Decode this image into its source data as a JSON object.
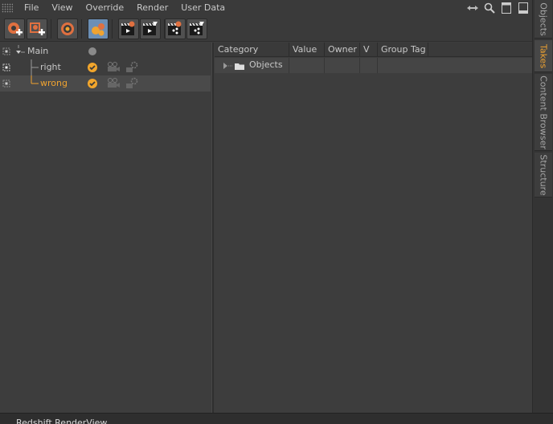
{
  "menubar": {
    "items": [
      "File",
      "View",
      "Override",
      "Render",
      "User Data"
    ]
  },
  "toolbar": {
    "buttons": [
      {
        "icon": "add-take-icon"
      },
      {
        "icon": "add-child-take-icon"
      },
      {
        "icon": "auto-take-icon"
      },
      {
        "icon": "override-groups-icon",
        "active": true
      },
      {
        "icon": "clapper-render-icon"
      },
      {
        "icon": "clapper-render-all-icon"
      },
      {
        "icon": "clapper-share-icon"
      },
      {
        "icon": "clapper-share-all-icon"
      }
    ]
  },
  "tree": {
    "rows": [
      {
        "label": "Main"
      },
      {
        "label": "right"
      },
      {
        "label": "wrong",
        "selected": true
      }
    ]
  },
  "table": {
    "columns": [
      "Category",
      "Value",
      "Owner",
      "V",
      "Group Tag"
    ],
    "rows": [
      {
        "category": "Objects"
      }
    ]
  },
  "side_tabs": [
    {
      "label": "Objects"
    },
    {
      "label": "Takes",
      "active": true
    },
    {
      "label": "Content Browser"
    },
    {
      "label": "Structure"
    }
  ],
  "bottom": {
    "title": "Redshift RenderView"
  },
  "colors": {
    "accent": "#f0a330",
    "panel": "#3d3d3d",
    "active_button": "#6c8fb5"
  }
}
